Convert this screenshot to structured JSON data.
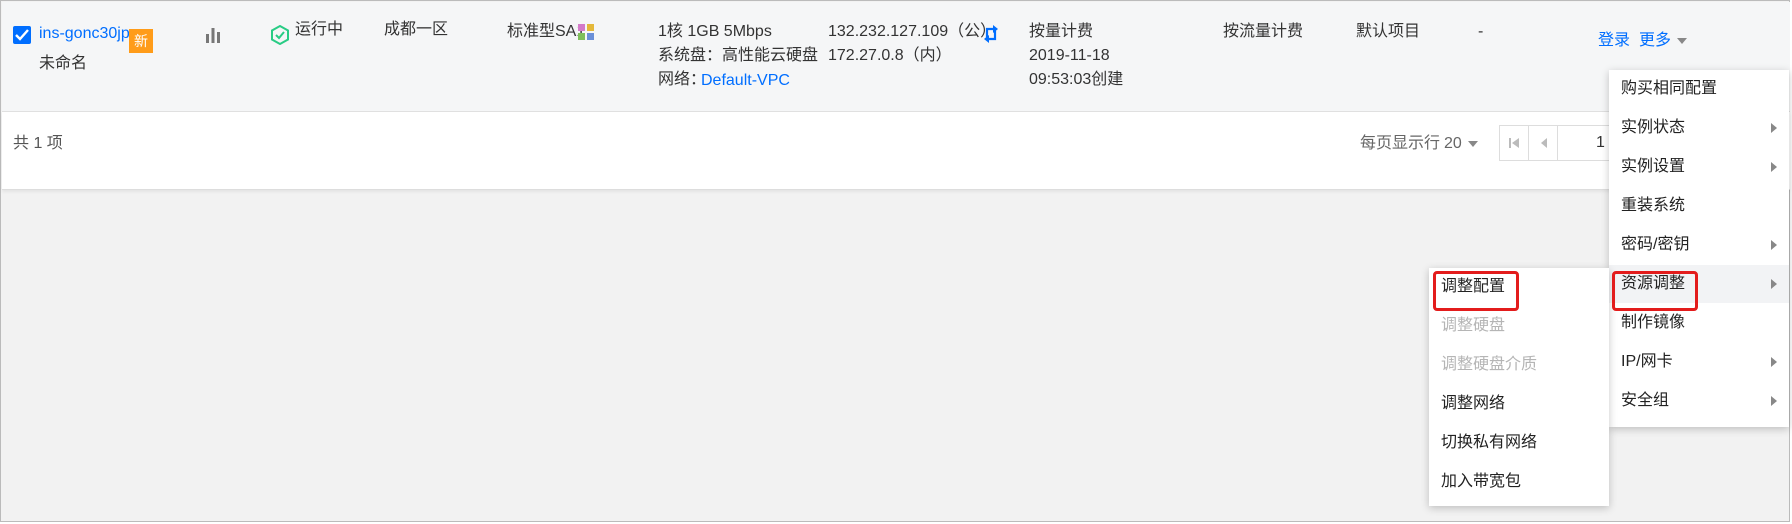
{
  "instance": {
    "id": "ins-gonc30jp",
    "badge": "新",
    "name": "未命名",
    "status": "运行中",
    "zone": "成都一区",
    "type": "标准型SA1",
    "config_line1": "1核 1GB 5Mbps",
    "config_line2": "系统盘：高性能云硬盘",
    "network_label": "网络：",
    "network_value": "Default-VPC",
    "ip_public": "132.232.127.109（公）",
    "ip_private": "172.27.0.8（内）",
    "billing": "按量计费",
    "created_date": "2019-11-18",
    "created_time": "09:53:03创建",
    "net_billing": "按流量计费",
    "project": "默认项目",
    "dash": "-",
    "login": "登录",
    "more": "更多"
  },
  "footer": {
    "total": "共 1 项",
    "per_page_label": "每页显示行",
    "per_page_value": "20",
    "page_input": "1"
  },
  "more_menu": {
    "items": [
      {
        "label": "购买相同配置",
        "submenu": false
      },
      {
        "label": "实例状态",
        "submenu": true
      },
      {
        "label": "实例设置",
        "submenu": true
      },
      {
        "label": "重装系统",
        "submenu": false
      },
      {
        "label": "密码/密钥",
        "submenu": true
      },
      {
        "label": "资源调整",
        "submenu": true
      },
      {
        "label": "制作镜像",
        "submenu": false
      },
      {
        "label": "IP/网卡",
        "submenu": true
      },
      {
        "label": "安全组",
        "submenu": true
      }
    ]
  },
  "resource_submenu": {
    "items": [
      {
        "label": "调整配置",
        "disabled": false
      },
      {
        "label": "调整硬盘",
        "disabled": true
      },
      {
        "label": "调整硬盘介质",
        "disabled": true
      },
      {
        "label": "调整网络",
        "disabled": false
      },
      {
        "label": "切换私有网络",
        "disabled": false
      },
      {
        "label": "加入带宽包",
        "disabled": false
      }
    ]
  },
  "colors": {
    "accent": "#006eff",
    "badge": "#ff9c19",
    "running": "#29cc85",
    "highlight": "#e31c1c"
  }
}
